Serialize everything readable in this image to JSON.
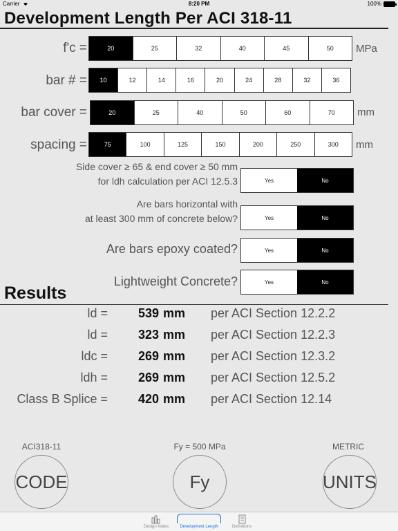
{
  "status": {
    "carrier": "Carrier",
    "time": "8:20 PM",
    "battery": "100%"
  },
  "title": "Development Length Per ACI 318-11",
  "inputs": {
    "fc": {
      "label": "f'c =",
      "unit": "MPa",
      "options": [
        "20",
        "25",
        "32",
        "40",
        "45",
        "50"
      ],
      "selected": "20"
    },
    "bar": {
      "label": "bar # =",
      "unit": "",
      "options": [
        "10",
        "12",
        "14",
        "16",
        "20",
        "24",
        "28",
        "32",
        "36"
      ],
      "selected": "10"
    },
    "cover": {
      "label": "bar cover =",
      "unit": "mm",
      "options": [
        "20",
        "25",
        "40",
        "50",
        "60",
        "70"
      ],
      "selected": "20"
    },
    "spacing": {
      "label": "spacing =",
      "unit": "mm",
      "options": [
        "75",
        "100",
        "125",
        "150",
        "200",
        "250",
        "300"
      ],
      "selected": "75"
    }
  },
  "questions": [
    {
      "line1": "Side cover ≥ 65 & end cover ≥ 50 mm",
      "line2": "for ldh calculation per ACI 12.5.3",
      "yes": "Yes",
      "no": "No",
      "selected": "No"
    },
    {
      "line1": "Are bars horizontal with",
      "line2": "at least 300 mm of concrete below?",
      "yes": "Yes",
      "no": "No",
      "selected": "No"
    },
    {
      "line1": "Are bars epoxy coated?",
      "yes": "Yes",
      "no": "No",
      "selected": "No"
    },
    {
      "line1": "Lightweight Concrete?",
      "yes": "Yes",
      "no": "No",
      "selected": "No"
    }
  ],
  "results": {
    "heading": "Results",
    "rows": [
      {
        "label": "ld =",
        "value": "539",
        "unit": "mm",
        "ref": "per ACI Section 12.2.2"
      },
      {
        "label": "ld =",
        "value": "323",
        "unit": "mm",
        "ref": "per ACI Section 12.2.3"
      },
      {
        "label": "ldc =",
        "value": "269",
        "unit": "mm",
        "ref": "per ACI Section 12.3.2"
      },
      {
        "label": "ldh =",
        "value": "269",
        "unit": "mm",
        "ref": "per ACI Section 12.5.2"
      },
      {
        "label": "Class B Splice =",
        "value": "420",
        "unit": "mm",
        "ref": "per ACI Section 12.14"
      }
    ]
  },
  "buttons": {
    "code": {
      "caption": "ACI318-11",
      "label": "CODE"
    },
    "fy": {
      "caption": "Fy = 500 MPa",
      "label": "Fy"
    },
    "units": {
      "caption": "METRIC",
      "label": "UNITS"
    }
  },
  "tabs": [
    {
      "label": "Design Notes",
      "icon": "design-notes-icon"
    },
    {
      "label": "Development Length",
      "icon": "development-length-icon",
      "active": true
    },
    {
      "label": "Definitions",
      "icon": "definitions-icon"
    }
  ],
  "colors": {
    "selected": "#000000",
    "accent": "#1a6fd8",
    "background": "#e8e8e8"
  }
}
